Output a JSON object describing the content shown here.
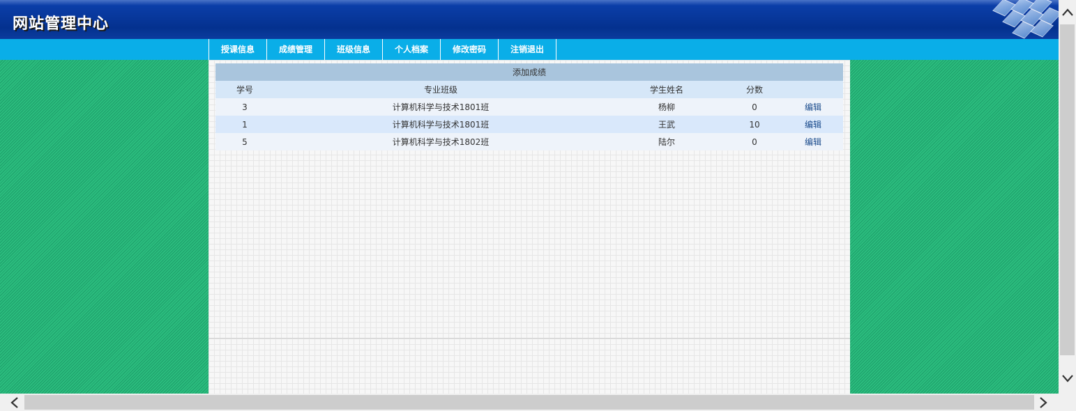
{
  "header": {
    "title": "网站管理中心",
    "gradient_top": "#4a73c7",
    "gradient_main": "#04318f"
  },
  "nav": {
    "items": [
      {
        "label": "授课信息"
      },
      {
        "label": "成绩管理"
      },
      {
        "label": "班级信息"
      },
      {
        "label": "个人档案"
      },
      {
        "label": "修改密码"
      },
      {
        "label": "注销退出"
      }
    ],
    "bar_color": "#0aaee8"
  },
  "grades_table": {
    "caption": "添加成绩",
    "columns": [
      "学号",
      "专业班级",
      "学生姓名",
      "分数",
      ""
    ],
    "rows": [
      {
        "student_id": "3",
        "class": "计算机科学与技术1801班",
        "name": "杨柳",
        "score": "0",
        "action": "编辑"
      },
      {
        "student_id": "1",
        "class": "计算机科学与技术1801班",
        "name": "王武",
        "score": "10",
        "action": "编辑"
      },
      {
        "student_id": "5",
        "class": "计算机科学与技术1802班",
        "name": "陆尔",
        "score": "0",
        "action": "编辑"
      }
    ]
  },
  "icons": {
    "scroll_up": "chevron-up-icon",
    "scroll_down": "chevron-down-icon",
    "scroll_left": "chevron-left-icon",
    "scroll_right": "chevron-right-icon"
  },
  "colors": {
    "background_stripe": "#2bbd7e",
    "caption_bg": "#a9c5dd",
    "row_alt_bg": "#d9e8fb",
    "link": "#1a4b8c"
  }
}
